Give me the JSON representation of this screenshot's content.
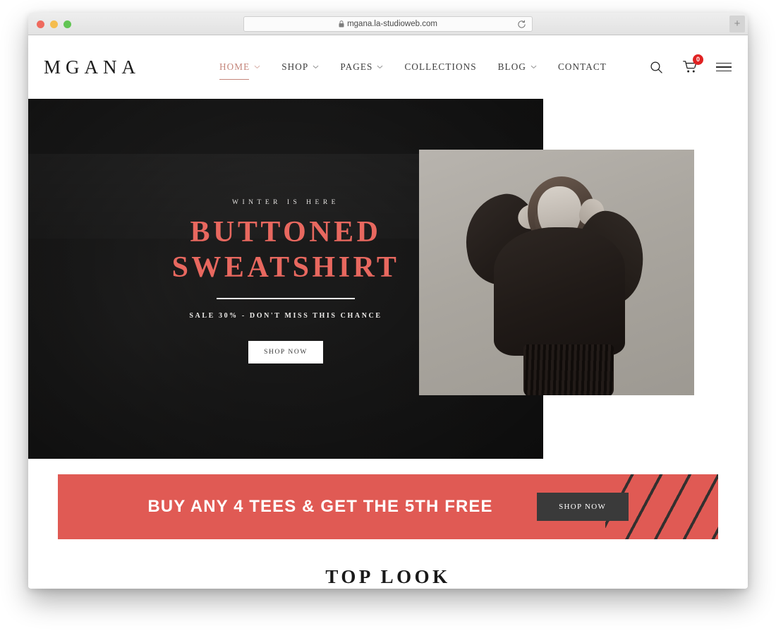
{
  "browser": {
    "url": "mgana.la-studioweb.com",
    "lock_icon": "lock-icon",
    "reload_icon": "reload-icon",
    "new_tab_label": "+",
    "traffic_lights": [
      "close",
      "minimize",
      "maximize"
    ]
  },
  "header": {
    "logo": "MGANA",
    "nav": [
      {
        "label": "HOME",
        "has_dropdown": true,
        "active": true
      },
      {
        "label": "SHOP",
        "has_dropdown": true,
        "active": false
      },
      {
        "label": "PAGES",
        "has_dropdown": true,
        "active": false
      },
      {
        "label": "COLLECTIONS",
        "has_dropdown": false,
        "active": false
      },
      {
        "label": "BLOG",
        "has_dropdown": true,
        "active": false
      },
      {
        "label": "CONTACT",
        "has_dropdown": false,
        "active": false
      }
    ],
    "icons": {
      "search": "search-icon",
      "cart": "cart-icon",
      "cart_count": "0",
      "menu": "hamburger-icon"
    }
  },
  "hero": {
    "eyebrow": "WINTER IS HERE",
    "title_line1": "BUTTONED",
    "title_line2": "SWEATSHIRT",
    "subtitle": "SALE 30% - DON'T MISS THIS CHANCE",
    "cta_label": "SHOP NOW"
  },
  "promo": {
    "text": "BUY ANY 4 TEES & GET THE 5TH FREE",
    "cta_label": "SHOP NOW"
  },
  "sections": {
    "top_look_heading": "TOP LOOK"
  },
  "colors": {
    "accent_coral": "#e05a54",
    "hero_title": "#e8685f",
    "nav_active": "#c4857a",
    "cart_badge": "#e02222",
    "dark_button": "#3a3a3a",
    "hero_bg": "#1f1d1c"
  }
}
